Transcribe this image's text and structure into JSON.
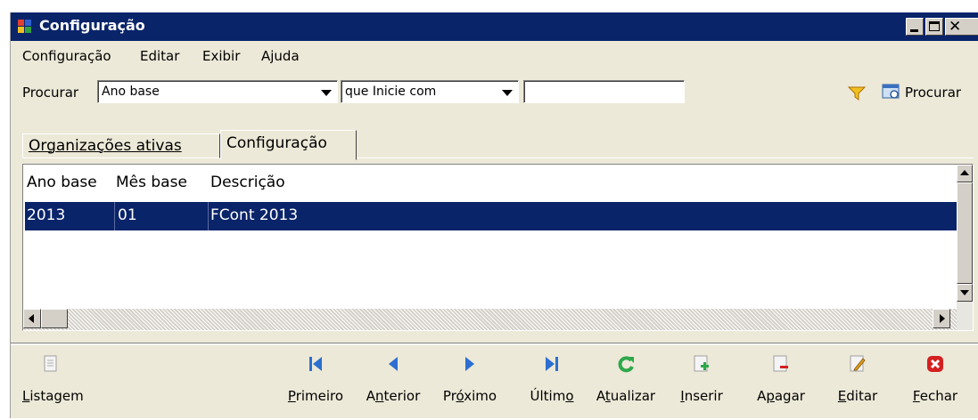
{
  "window": {
    "title": "Configuração",
    "controls": [
      "minimize",
      "maximize",
      "close"
    ]
  },
  "menu": [
    "Configuração",
    "Editar",
    "Exibir",
    "Ajuda"
  ],
  "search": {
    "label": "Procurar",
    "field_value": "Ano base",
    "condition_value": "que Inicie com",
    "text_value": "",
    "button_label": "Procurar"
  },
  "tabs": [
    {
      "label": "Organizações ativas",
      "active": false
    },
    {
      "label": "Configuração",
      "active": true
    }
  ],
  "grid": {
    "columns": [
      "Ano base",
      "Mês base",
      "Descrição"
    ],
    "rows": [
      {
        "ano": "2013",
        "mes": "01",
        "descricao": "FCont 2013",
        "selected": true
      }
    ]
  },
  "toolbar": {
    "listagem": {
      "pre": "",
      "key": "L",
      "post": "istagem"
    },
    "primeiro": {
      "pre": "",
      "key": "P",
      "post": "rimeiro"
    },
    "anterior": {
      "pre": "A",
      "key": "n",
      "post": "terior"
    },
    "proximo": {
      "pre": "Pr",
      "key": "ó",
      "post": "ximo"
    },
    "ultimo": {
      "pre": "Últim",
      "key": "o",
      "post": ""
    },
    "atualizar": {
      "pre": "A",
      "key": "t",
      "post": "ualizar"
    },
    "inserir": {
      "pre": "",
      "key": "I",
      "post": "nserir"
    },
    "apagar": {
      "pre": "A",
      "key": "p",
      "post": "agar"
    },
    "editar": {
      "pre": "",
      "key": "E",
      "post": "ditar"
    },
    "fechar": {
      "pre": "",
      "key": "F",
      "post": "echar"
    }
  },
  "colors": {
    "titlebar": "#0a246a",
    "selection": "#0a246a",
    "nav_icons": "#2c6fd0",
    "refresh_icon": "#2ea84a",
    "close_icon": "#d42020"
  }
}
